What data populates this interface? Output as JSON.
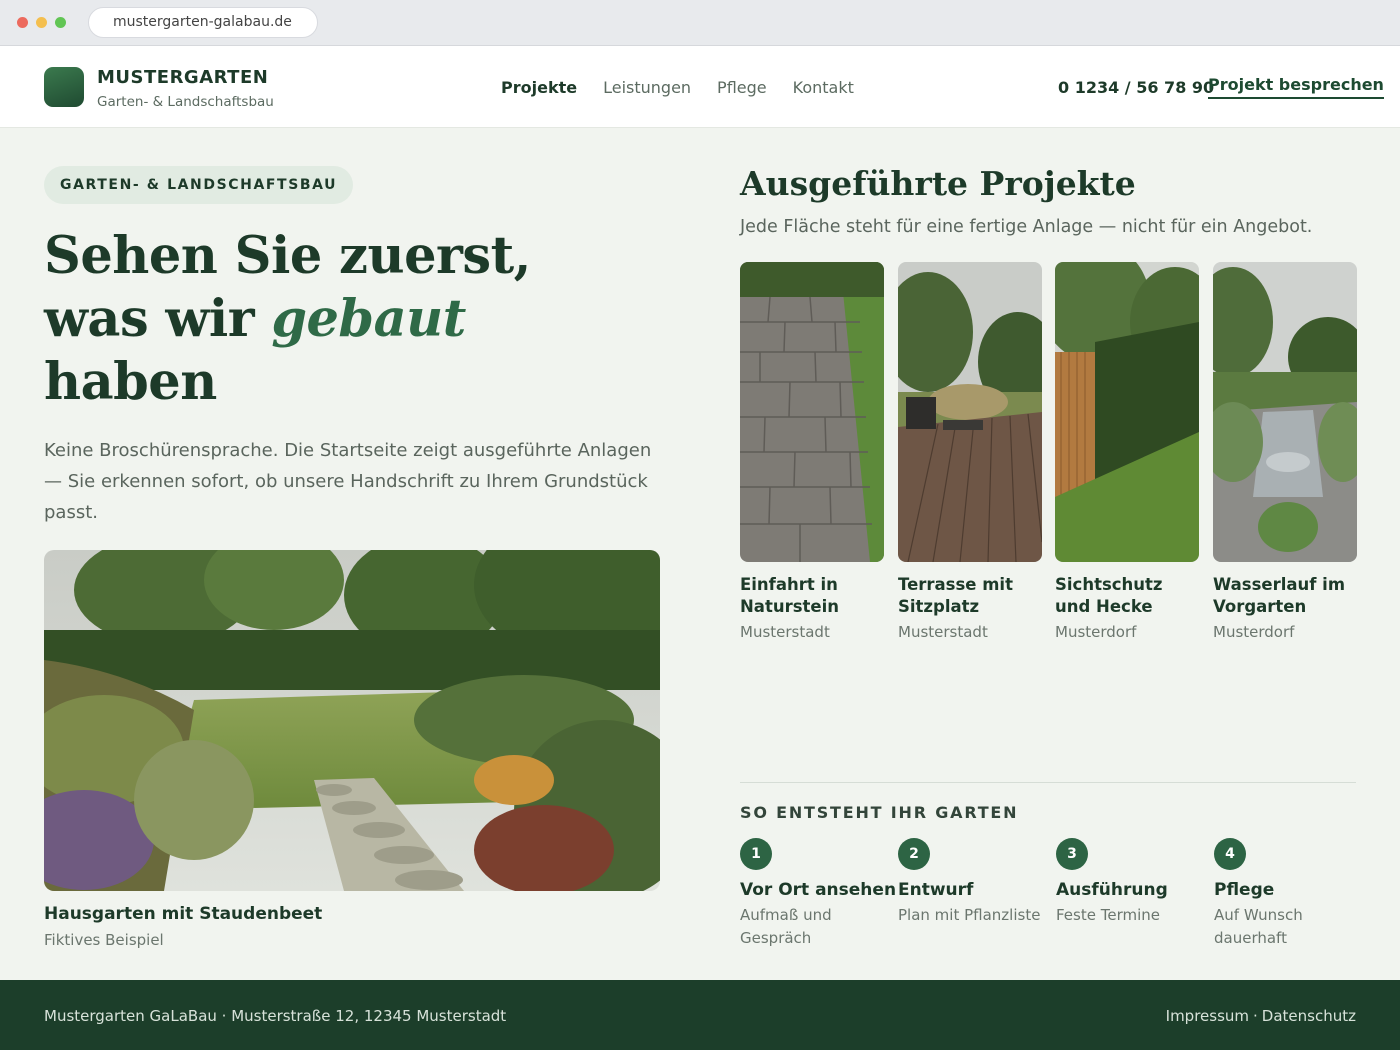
{
  "browser": {
    "url": "mustergarten-galabau.de"
  },
  "header": {
    "brand": "MUSTERGARTEN",
    "tagline": "Garten- & Landschaftsbau",
    "nav": [
      "Projekte",
      "Leistungen",
      "Pflege",
      "Kontakt"
    ],
    "active_nav": "Projekte",
    "phone": "0 1234 / 56 78 90",
    "cta": "Projekt besprechen"
  },
  "hero": {
    "badge": "GARTEN- & LANDSCHAFTSBAU",
    "title_line1": "Sehen Sie zuerst,",
    "title_line2_prefix": "was wir ",
    "title_line2_emph": "gebaut",
    "title_line3": "haben",
    "text": "Keine Broschürensprache. Die Startseite zeigt ausgeführte Anlagen — Sie erkennen sofort, ob unsere Handschrift zu Ihrem Grundstück passt.",
    "feature_caption": "Hausgarten mit Staudenbeet",
    "feature_sub": "Fiktives Beispiel"
  },
  "projects": {
    "title": "Ausgeführte Projekte",
    "subtitle": "Jede Fläche steht für eine fertige Anlage — nicht für ein Angebot.",
    "items": [
      {
        "name": "Einfahrt in Naturstein",
        "place": "Musterstadt"
      },
      {
        "name": "Terrasse mit Sitzplatz",
        "place": "Musterstadt"
      },
      {
        "name": "Sichtschutz und Hecke",
        "place": "Musterdorf"
      },
      {
        "name": "Wasserlauf im Vorgarten",
        "place": "Musterdorf"
      }
    ]
  },
  "steps": {
    "heading": "SO ENTSTEHT IHR GARTEN",
    "items": [
      {
        "num": "1",
        "title": "Vor Ort ansehen",
        "desc": "Aufmaß und Gespräch"
      },
      {
        "num": "2",
        "title": "Entwurf",
        "desc": "Plan mit Pflanzliste"
      },
      {
        "num": "3",
        "title": "Ausführung",
        "desc": "Feste Termine"
      },
      {
        "num": "4",
        "title": "Pflege",
        "desc": "Auf Wunsch dauerhaft"
      }
    ]
  },
  "footer": {
    "address": "Mustergarten GaLaBau · Musterstraße 12, 12345 Musterstadt",
    "imprint": "Impressum",
    "privacy": "Datenschutz",
    "separator": "·"
  },
  "colors": {
    "primary": "#1d3a29",
    "accent": "#2f6a47",
    "background": "#f1f4ef",
    "footer": "#1c3e2a"
  }
}
